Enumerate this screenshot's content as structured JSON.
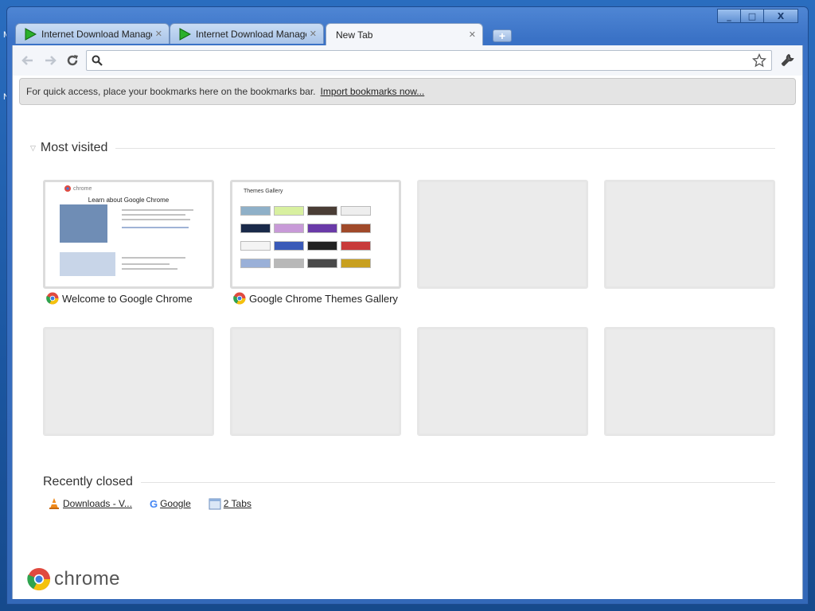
{
  "window": {
    "controls": [
      "_",
      "□",
      "X"
    ]
  },
  "tabs": [
    {
      "title": "Internet Download Manager: T",
      "active": false
    },
    {
      "title": "Internet Download Manager: V",
      "active": false
    },
    {
      "title": "New Tab",
      "active": true
    }
  ],
  "toolbar": {
    "omnibox_value": ""
  },
  "bookmark_bar": {
    "message": "For quick access, place your bookmarks here on the bookmarks bar.",
    "import_link": "Import bookmarks now..."
  },
  "most_visited": {
    "heading": "Most visited",
    "tiles": [
      {
        "label": "Welcome to Google Chrome",
        "preview": {
          "title": "Learn about Google Chrome"
        }
      },
      {
        "label": "Google Chrome Themes Gallery",
        "preview": {
          "title": "Themes Gallery"
        }
      },
      {
        "label": ""
      },
      {
        "label": ""
      },
      {
        "label": ""
      },
      {
        "label": ""
      },
      {
        "label": ""
      },
      {
        "label": ""
      }
    ]
  },
  "recently_closed": {
    "heading": "Recently closed",
    "items": [
      {
        "label": "Downloads - V...",
        "icon": "vlc-cone-icon"
      },
      {
        "label": "Google",
        "icon": "google-g-icon"
      },
      {
        "label": "2 Tabs",
        "icon": "window-icon"
      }
    ]
  },
  "footer": {
    "logo_text": "chrome"
  },
  "colors": {
    "window_frame": "#3a72c6",
    "tab_active": "#f4f6fa",
    "bookmark_bar_bg": "#e4e4e4",
    "tile_empty": "#ebebeb"
  }
}
